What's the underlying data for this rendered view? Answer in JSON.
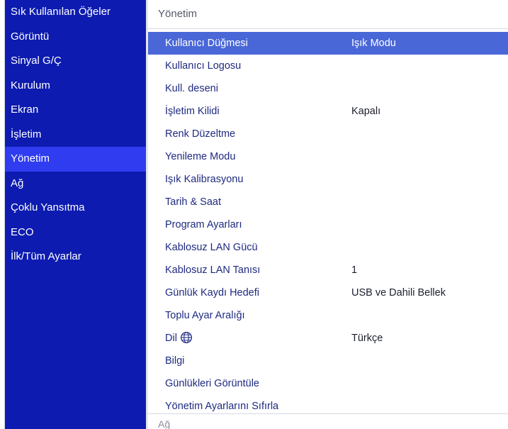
{
  "colors": {
    "sidebar_bg": "#0d1bb0",
    "sidebar_active": "#2f3cf0",
    "row_selected": "#4a67d8",
    "label_text": "#1f2a80"
  },
  "sidebar": {
    "items": [
      {
        "label": "Sık Kullanılan Öğeler"
      },
      {
        "label": "Görüntü"
      },
      {
        "label": "Sinyal G/Ç"
      },
      {
        "label": "Kurulum"
      },
      {
        "label": "Ekran"
      },
      {
        "label": "İşletim"
      },
      {
        "label": "Yönetim",
        "active": true
      },
      {
        "label": "Ağ"
      },
      {
        "label": "Çoklu Yansıtma"
      },
      {
        "label": "ECO"
      },
      {
        "label": "İlk/Tüm Ayarlar"
      }
    ]
  },
  "main": {
    "header": "Yönetim",
    "rows": [
      {
        "label": "Kullanıcı Düğmesi",
        "value": "Işık Modu"
      },
      {
        "label": "Kullanıcı Logosu",
        "value": ""
      },
      {
        "label": "Kull. deseni",
        "value": ""
      },
      {
        "label": "İşletim Kilidi",
        "value": "Kapalı"
      },
      {
        "label": "Renk Düzeltme",
        "value": ""
      },
      {
        "label": "Yenileme Modu",
        "value": ""
      },
      {
        "label": "Işık Kalibrasyonu",
        "value": ""
      },
      {
        "label": "Tarih & Saat",
        "value": ""
      },
      {
        "label": "Program Ayarları",
        "value": ""
      },
      {
        "label": "Kablosuz LAN Gücü",
        "value": ""
      },
      {
        "label": "Kablosuz LAN Tanısı",
        "value": "1"
      },
      {
        "label": "Günlük Kaydı Hedefi",
        "value": "USB ve Dahili Bellek"
      },
      {
        "label": "Toplu Ayar Aralığı",
        "value": ""
      },
      {
        "label": "Dil",
        "value": "Türkçe",
        "icon": "globe-icon"
      },
      {
        "label": "Bilgi",
        "value": ""
      },
      {
        "label": "Günlükleri Görüntüle",
        "value": ""
      },
      {
        "label": "Yönetim Ayarlarını Sıfırla",
        "value": ""
      }
    ],
    "next_section": "Ağ"
  }
}
